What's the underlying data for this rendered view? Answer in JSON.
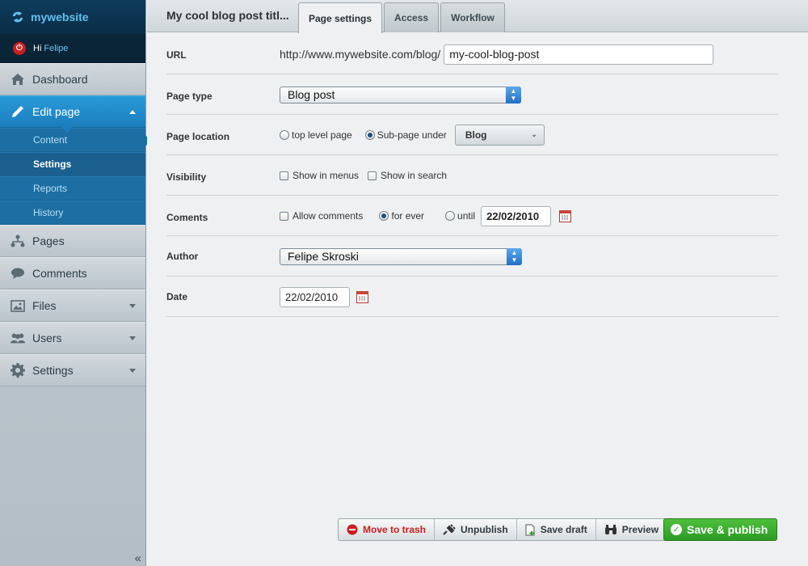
{
  "brand": {
    "name": "mywebsite"
  },
  "user": {
    "greeting": "Hi",
    "name": "Felipe"
  },
  "nav": {
    "dashboard": "Dashboard",
    "edit_page": "Edit page",
    "sub": [
      "Content",
      "Settings",
      "Reports",
      "History"
    ],
    "pages": "Pages",
    "comments": "Comments",
    "files": "Files",
    "users": "Users",
    "settings": "Settings",
    "collapse": "«"
  },
  "header": {
    "title": "My cool blog post titl...",
    "tabs": [
      "Page settings",
      "Access",
      "Workflow"
    ]
  },
  "form": {
    "url": {
      "label": "URL",
      "prefix": "http://www.mywebsite.com/blog/",
      "slug": "my-cool-blog-post"
    },
    "page_type": {
      "label": "Page type",
      "value": "Blog post"
    },
    "page_location": {
      "label": "Page location",
      "opt1": "top level page",
      "opt2": "Sub-page under",
      "parent": "Blog"
    },
    "visibility": {
      "label": "Visibility",
      "opt1": "Show in menus",
      "opt2": "Show in search"
    },
    "comments": {
      "label": "Coments",
      "allow": "Allow comments",
      "forever": "for ever",
      "until": "until",
      "until_date": "22/02/2010"
    },
    "author": {
      "label": "Author",
      "value": "Felipe Skroski"
    },
    "date": {
      "label": "Date",
      "value": "22/02/2010"
    }
  },
  "actions": {
    "trash": "Move to trash",
    "unpublish": "Unpublish",
    "save_draft": "Save draft",
    "preview": "Preview",
    "publish": "Save & publish"
  },
  "colors": {
    "accent": "#1b7dbd",
    "brand_bg": "#0e3c5c",
    "publish": "#2b9a24",
    "danger": "#c81f1f"
  }
}
